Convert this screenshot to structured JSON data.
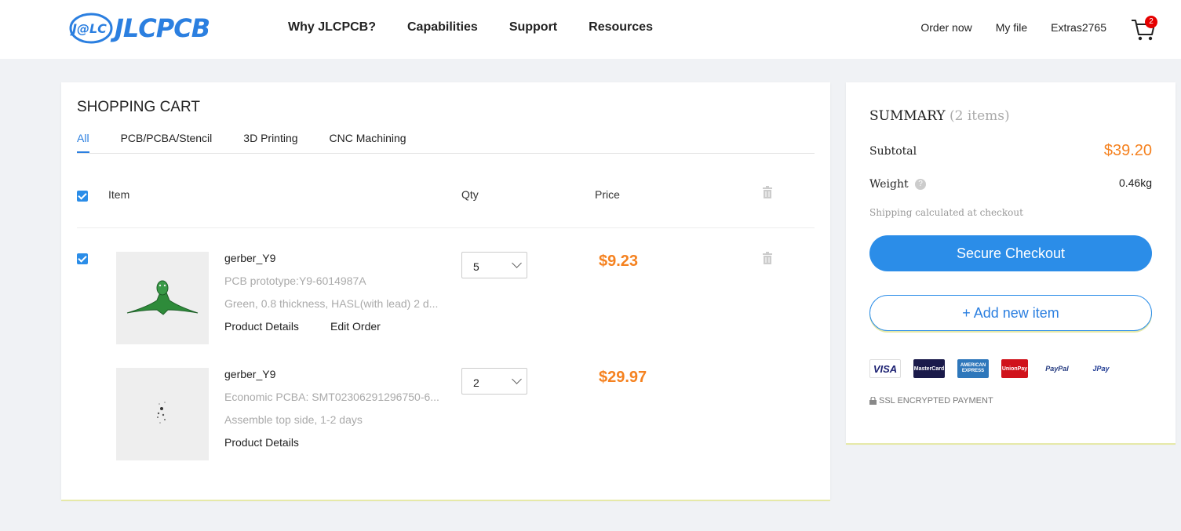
{
  "header": {
    "logo_text": "JLCPCB",
    "logo_mark": "J@LC",
    "nav": [
      "Why JLCPCB?",
      "Capabilities",
      "Support",
      "Resources"
    ],
    "right_links": [
      "Order now",
      "My file",
      "Extras2765"
    ],
    "cart_count": "2"
  },
  "cart": {
    "title": "SHOPPING CART",
    "tabs": [
      "All",
      "PCB/PCBA/Stencil",
      "3D Printing",
      "CNC Machining"
    ],
    "active_tab": "All",
    "columns": {
      "item": "Item",
      "qty": "Qty",
      "price": "Price"
    },
    "items": [
      {
        "name": "gerber_Y9",
        "line1": "PCB prototype:Y9-6014987A",
        "line2": "Green, 0.8 thickness, HASL(with lead) 2 d...",
        "link1": "Product Details",
        "link2": "Edit Order",
        "qty": "5",
        "price": "$9.23",
        "checked": true
      },
      {
        "name": "gerber_Y9",
        "line1": "Economic PCBA: SMT02306291296750-6...",
        "line2": "Assemble top side, 1-2 days",
        "link1": "Product Details",
        "qty": "2",
        "price": "$29.97"
      }
    ]
  },
  "summary": {
    "title": "SUMMARY",
    "count": "(2 items)",
    "subtotal_label": "Subtotal",
    "subtotal": "$39.20",
    "weight_label": "Weight",
    "weight_help": "?",
    "weight": "0.46kg",
    "shipping_note": "Shipping calculated at checkout",
    "checkout_label": "Secure Checkout",
    "add_label": "+   Add new item",
    "payment_icons": [
      "VISA",
      "MasterCard",
      "AMERICAN EXPRESS",
      "UnionPay",
      "PayPal",
      "JPay"
    ],
    "ssl_text": "SSL ENCRYPTED PAYMENT"
  },
  "colors": {
    "accent": "#2b8de8",
    "price": "#f58220",
    "badge": "#e50000"
  }
}
